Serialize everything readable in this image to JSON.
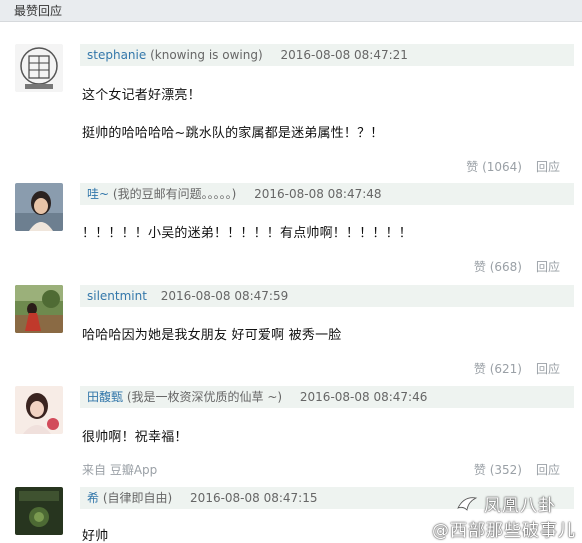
{
  "header": {
    "title": "最赞回应"
  },
  "comments": [
    {
      "username": "stephanie",
      "signature": "(knowing is owing)",
      "timestamp": "2016-08-08 08:47:21",
      "lines": [
        "这个女记者好漂亮！",
        "挺帅的哈哈哈哈~跳水队的家属都是迷弟属性！？！"
      ],
      "likes": "赞 (1064)",
      "reply": "回应"
    },
    {
      "username": "哇~",
      "signature": "(我的豆邮有问题。。。。。)",
      "timestamp": "2016-08-08 08:47:48",
      "lines": [
        "！！！！！小吴的迷弟！！！！！有点帅啊！！！！！！"
      ],
      "likes": "赞 (668)",
      "reply": "回应"
    },
    {
      "username": "silentmint",
      "signature": "",
      "timestamp": "2016-08-08 08:47:59",
      "lines": [
        "哈哈哈因为她是我女朋友 好可爱啊 被秀一脸"
      ],
      "likes": "赞 (621)",
      "reply": "回应"
    },
    {
      "username": "田馥甄",
      "signature": "(我是一枚资深优质的仙草 ~)",
      "timestamp": "2016-08-08 08:47:46",
      "lines": [
        "很帅啊！祝幸福！"
      ],
      "source": "来自 豆瓣App",
      "likes": "赞 (352)",
      "reply": "回应"
    },
    {
      "username": "希",
      "signature": "(自律即自由)",
      "timestamp": "2016-08-08 08:47:15",
      "lines": [
        "好帅"
      ]
    }
  ],
  "watermark": {
    "line1": "凤凰八卦",
    "line2": "@西部那些破事儿"
  },
  "icons": {
    "watermark": "phoenix-logo-icon"
  }
}
